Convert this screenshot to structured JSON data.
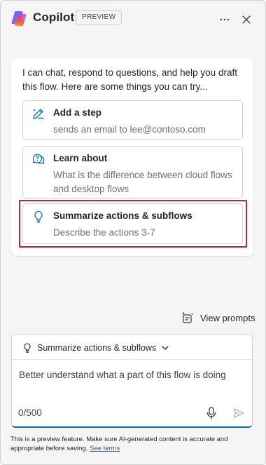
{
  "header": {
    "title": "Copilot",
    "badge": "PREVIEW",
    "more_icon": "more-horizontal-icon",
    "close_icon": "close-icon"
  },
  "message": {
    "intro": "I can chat, respond to questions, and help you draft this flow. Here are some things you can try...",
    "suggestions": [
      {
        "icon": "pen-sparkle-icon",
        "title": "Add a step",
        "description": "sends an email to lee@contoso.com"
      },
      {
        "icon": "chat-question-icon",
        "title": "Learn about",
        "description": "What is the difference between cloud flows and desktop flows"
      },
      {
        "icon": "lightbulb-icon",
        "title": "Summarize actions & subflows",
        "description": "Describe the actions 3-7"
      }
    ]
  },
  "view_prompts": {
    "label": "View prompts",
    "icon": "prompts-sparkle-icon"
  },
  "composer": {
    "chip_label": "Summarize actions & subflows",
    "text": "Better understand what a part of this flow is doing",
    "counter": "0/500",
    "mic_icon": "microphone-icon",
    "send_icon": "send-icon"
  },
  "disclaimer": {
    "text": "This is a preview feature. Make sure AI-generated content is accurate and appropriate before saving.",
    "link": "See terms"
  },
  "colors": {
    "accent": "#0f6cbd",
    "highlight": "#c4262e",
    "pane_background": "#f5f5f5"
  }
}
